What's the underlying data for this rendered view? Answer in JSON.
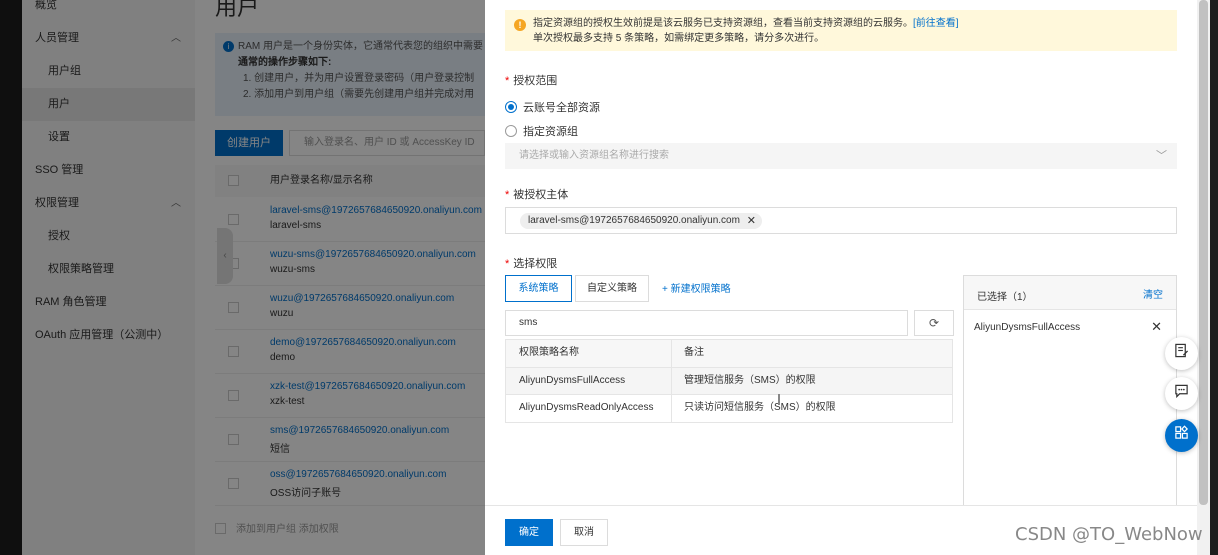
{
  "background": {
    "sidebar": [
      {
        "label": "概览",
        "level": 1
      },
      {
        "label": "人员管理",
        "level": 1,
        "caret": "︿"
      },
      {
        "label": "用户组",
        "level": 2
      },
      {
        "label": "用户",
        "level": 2,
        "active": true
      },
      {
        "label": "设置",
        "level": 2
      },
      {
        "label": "SSO 管理",
        "level": 1
      },
      {
        "label": "权限管理",
        "level": 1,
        "caret": "︿"
      },
      {
        "label": "授权",
        "level": 2
      },
      {
        "label": "权限策略管理",
        "level": 2
      },
      {
        "label": "RAM 角色管理",
        "level": 1
      },
      {
        "label": "OAuth 应用管理（公测中）",
        "level": 1
      }
    ],
    "page_title": "用户",
    "info_lines": [
      "RAM 用户是一个身份实体，它通常代表您的组织中需要",
      "通常的操作步骤如下:",
      "1. 创建用户，并为用户设置登录密码（用户登录控制",
      "2. 添加用户到用户组（需要先创建用户组并完成对用"
    ],
    "create_button": "创建用户",
    "search_placeholder": "输入登录名、用户 ID 或 AccessKey ID",
    "table_header": "用户登录名称/显示名称",
    "users": [
      {
        "login": "laravel-sms@1972657684650920.onaliyun.com",
        "display": "laravel-sms"
      },
      {
        "login": "wuzu-sms@1972657684650920.onaliyun.com",
        "display": "wuzu-sms"
      },
      {
        "login": "wuzu@1972657684650920.onaliyun.com",
        "display": "wuzu"
      },
      {
        "login": "demo@1972657684650920.onaliyun.com",
        "display": "demo"
      },
      {
        "login": "xzk-test@1972657684650920.onaliyun.com",
        "display": "xzk-test"
      },
      {
        "login": "sms@1972657684650920.onaliyun.com",
        "display": "短信"
      },
      {
        "login": "oss@1972657684650920.onaliyun.com",
        "display": "OSS访问子账号"
      }
    ],
    "footer_actions": "添加到用户组   添加权限"
  },
  "drawer": {
    "warning": {
      "line1": "指定资源组的授权生效前提是该云服务已支持资源组，查看当前支持资源组的云服务。",
      "link": "[前往查看]",
      "line2": "单次授权最多支持 5 条策略，如需绑定更多策略，请分多次进行。"
    },
    "scope": {
      "label": "授权范围",
      "option_all": "云账号全部资源",
      "option_group": "指定资源组",
      "selected": "all",
      "group_placeholder": "请选择或输入资源组名称进行搜索"
    },
    "principal": {
      "label": "被授权主体",
      "tag": "laravel-sms@1972657684650920.onaliyun.com"
    },
    "permissions": {
      "label": "选择权限",
      "tabs": [
        "系统策略",
        "自定义策略"
      ],
      "active_tab": 0,
      "new_policy": "+ 新建权限策略",
      "search_value": "sms",
      "columns": [
        "权限策略名称",
        "备注"
      ],
      "rows": [
        {
          "name": "AliyunDysmsFullAccess",
          "note": "管理短信服务（SMS）的权限",
          "selected": true
        },
        {
          "name": "AliyunDysmsReadOnlyAccess",
          "note": "只读访问短信服务（SMS）的权限",
          "selected": false
        }
      ],
      "selected_panel": {
        "title": "已选择（1）",
        "clear": "清空",
        "items": [
          "AliyunDysmsFullAccess"
        ]
      }
    },
    "ok_button": "确定",
    "cancel_button": "取消"
  },
  "floating_buttons": [
    "notes-icon",
    "chat-icon",
    "apps-icon"
  ],
  "watermark": "CSDN @TO_WebNow",
  "colors": {
    "primary": "#0070cc",
    "warning_bg": "#fff8db",
    "warning_icon": "#f5a623",
    "required": "#e00000"
  }
}
